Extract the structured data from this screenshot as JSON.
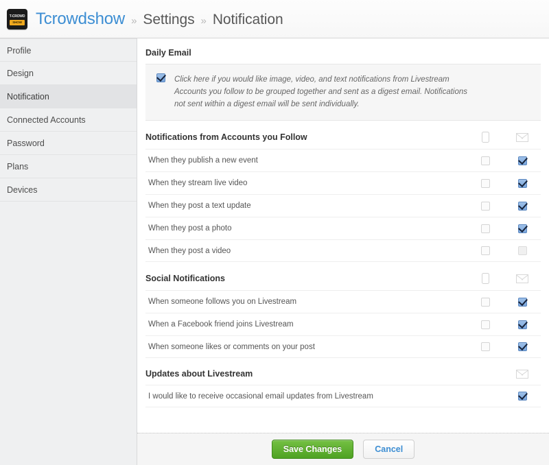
{
  "header": {
    "logo_line1": "T-CROWD",
    "logo_line2": "SHOW",
    "account": "Tcrowdshow",
    "sep": "»",
    "crumb2": "Settings",
    "crumb3": "Notification",
    "accent_color": "#3d8ed3"
  },
  "sidebar": {
    "items": [
      {
        "label": "Profile",
        "active": false
      },
      {
        "label": "Design",
        "active": false
      },
      {
        "label": "Notification",
        "active": true
      },
      {
        "label": "Connected Accounts",
        "active": false
      },
      {
        "label": "Password",
        "active": false
      },
      {
        "label": "Plans",
        "active": false
      },
      {
        "label": "Devices",
        "active": false
      }
    ]
  },
  "main": {
    "daily_email": {
      "title": "Daily Email",
      "checked": true,
      "text": "Click here if you would like image, video, and text notifications from Livestream Accounts you follow to be grouped together and sent as a digest email. Notifications not sent within a digest email will be sent individually."
    },
    "sections": [
      {
        "title": "Notifications from Accounts you Follow",
        "header_icons": [
          "phone-icon",
          "envelope-icon"
        ],
        "rows": [
          {
            "label": "When they publish a new event",
            "mobile": false,
            "email": true
          },
          {
            "label": "When they stream live video",
            "mobile": false,
            "email": true
          },
          {
            "label": "When they post a text update",
            "mobile": false,
            "email": true
          },
          {
            "label": "When they post a photo",
            "mobile": false,
            "email": true
          },
          {
            "label": "When they post a video",
            "mobile": false,
            "email": false
          }
        ]
      },
      {
        "title": "Social Notifications",
        "header_icons": [
          "phone-icon",
          "envelope-icon"
        ],
        "rows": [
          {
            "label": "When someone follows you on Livestream",
            "mobile": false,
            "email": true
          },
          {
            "label": "When a Facebook friend joins Livestream",
            "mobile": false,
            "email": true
          },
          {
            "label": "When someone likes or comments on your post",
            "mobile": false,
            "email": true
          }
        ]
      },
      {
        "title": "Updates about Livestream",
        "header_icons": [
          "envelope-icon"
        ],
        "rows": [
          {
            "label": "I would like to receive occasional email updates from Livestream",
            "mobile": null,
            "email": true
          }
        ]
      }
    ]
  },
  "footer": {
    "save_label": "Save Changes",
    "cancel_label": "Cancel",
    "save_color": "#5bb02b",
    "cancel_text_color": "#3d8ed3"
  }
}
